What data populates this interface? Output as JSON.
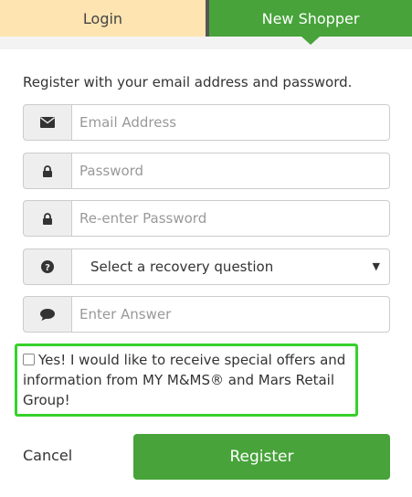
{
  "tabs": [
    {
      "label": "Login"
    },
    {
      "label": "New Shopper"
    }
  ],
  "intro": "Register with your email address and password.",
  "fields": {
    "email": {
      "placeholder": "Email Address",
      "icon": "envelope-icon"
    },
    "password": {
      "placeholder": "Password",
      "icon": "lock-icon"
    },
    "reenter_password": {
      "placeholder": "Re-enter Password",
      "icon": "lock-icon"
    },
    "recovery_question": {
      "selected": "Select a recovery question",
      "icon": "question-circle-icon"
    },
    "answer": {
      "placeholder": "Enter Answer",
      "icon": "speech-bubble-icon"
    }
  },
  "consent": {
    "label": "Yes! I would like to receive special offers and information from MY M&MS® and Mars Retail Group!",
    "checked": false
  },
  "actions": {
    "cancel": "Cancel",
    "register": "Register"
  },
  "colors": {
    "brand_green": "#47a33a",
    "login_tab": "#fde4b0",
    "highlight": "#36d12b"
  }
}
